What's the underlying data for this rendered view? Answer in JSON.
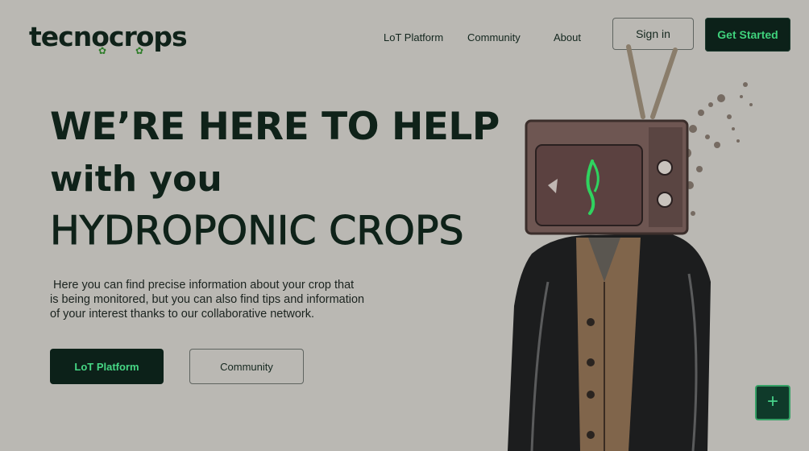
{
  "brand": {
    "name": "tecnocrops"
  },
  "nav": {
    "items": [
      {
        "label": "LoT Platform"
      },
      {
        "label": "Community"
      },
      {
        "label": "About"
      }
    ],
    "signin_label": "Sign in",
    "get_started_label": "Get Started"
  },
  "hero": {
    "line1": "WE’RE HERE TO HELP",
    "line2": "with you",
    "line3": "HYDROPONIC CROPS",
    "paragraph_1": " Here you can find precise information about your crop that",
    "paragraph_2": "is being monitored, but you can also find tips and information",
    "paragraph_3": "of your interest thanks to our collaborative network.",
    "primary_cta": "LoT Platform",
    "secondary_cta": "Community"
  },
  "fab": {
    "icon": "plus-icon",
    "label": "+"
  },
  "colors": {
    "background": "#bab8b3",
    "dark": "#0c2119",
    "accent": "#3fd27c"
  }
}
